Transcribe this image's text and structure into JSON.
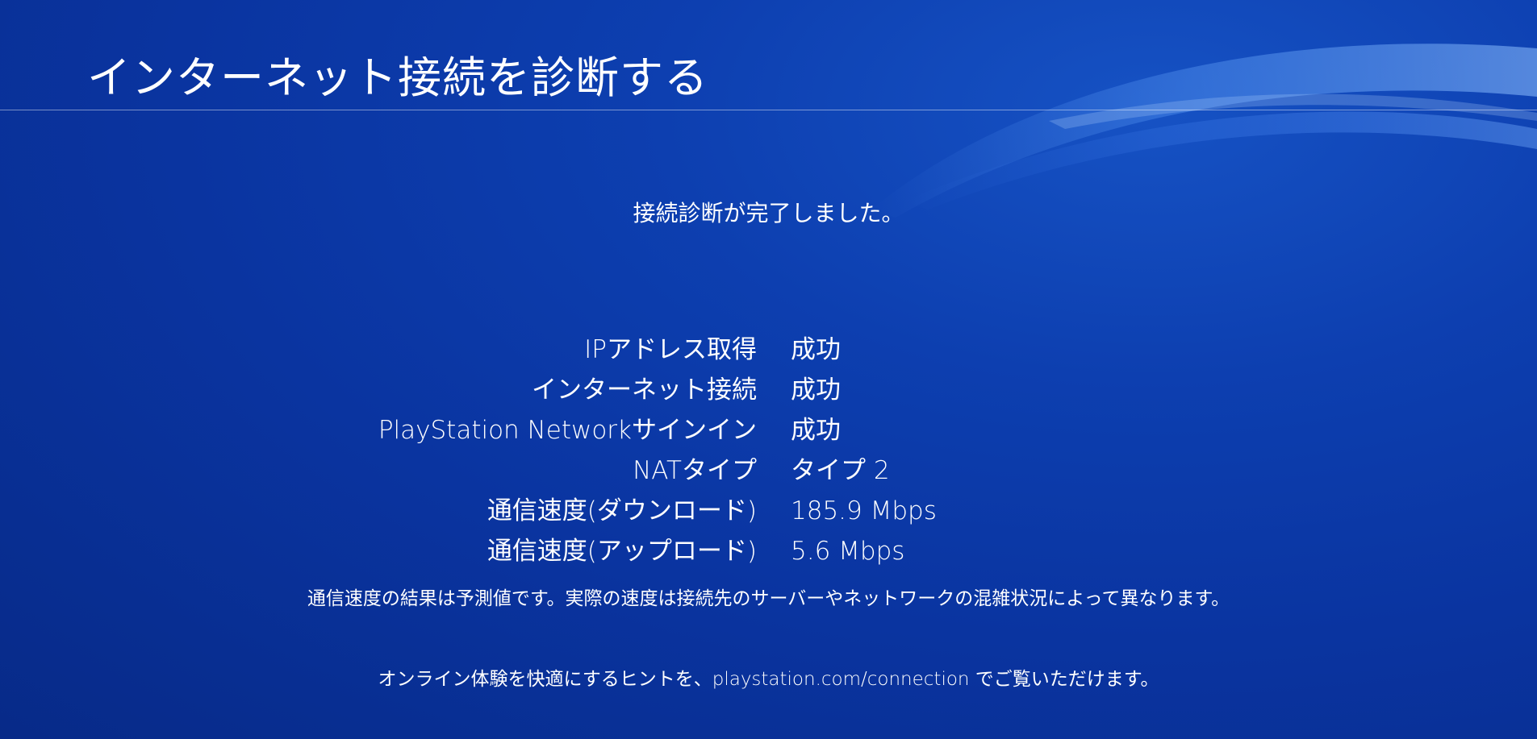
{
  "header": {
    "title": "インターネット接続を診断する"
  },
  "status": {
    "message": "接続診断が完了しました。"
  },
  "results": [
    {
      "label": "IPアドレス取得",
      "value": "成功"
    },
    {
      "label": "インターネット接続",
      "value": "成功"
    },
    {
      "label": "PlayStation Networkサインイン",
      "value": "成功"
    },
    {
      "label": "NATタイプ",
      "value": "タイプ 2"
    },
    {
      "label": "通信速度(ダウンロード)",
      "value": "185.9 Mbps"
    },
    {
      "label": "通信速度(アップロード)",
      "value": "5.6 Mbps"
    }
  ],
  "notes": {
    "speed_disclaimer": "通信速度の結果は予測値です。実際の速度は接続先のサーバーやネットワークの混雑状況によって異なります。",
    "hint": "オンライン体験を快適にするヒントを、playstation.com/connection でご覧いただけます。"
  },
  "colors": {
    "background": "#0a34a0",
    "text": "#ffffff"
  }
}
